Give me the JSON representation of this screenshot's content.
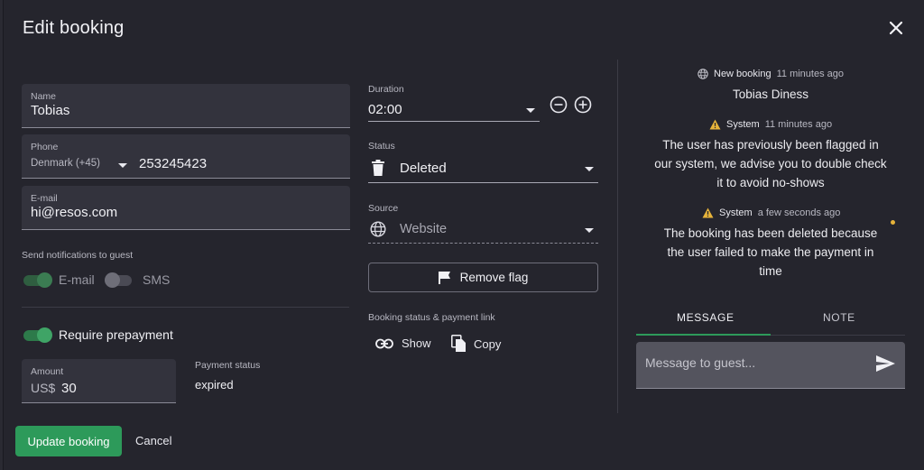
{
  "dialog": {
    "title": "Edit booking"
  },
  "guest": {
    "name_label": "Name",
    "name_value": "Tobias",
    "phone_label": "Phone",
    "country": "Denmark (+45)",
    "phone_value": "253245423",
    "email_label": "E-mail",
    "email_value": "hi@resos.com"
  },
  "notifications": {
    "label": "Send notifications to guest",
    "email": "E-mail",
    "sms": "SMS"
  },
  "prepayment": {
    "toggle_label": "Require prepayment",
    "amount_label": "Amount",
    "currency": "US$",
    "amount_value": "30",
    "payment_status_label": "Payment status",
    "payment_status_value": "expired"
  },
  "duration": {
    "label": "Duration",
    "value": "02:00"
  },
  "status": {
    "label": "Status",
    "value": "Deleted"
  },
  "source": {
    "label": "Source",
    "value": "Website"
  },
  "remove_flag": "Remove flag",
  "payment_link": {
    "label": "Booking status & payment link",
    "show": "Show",
    "copy": "Copy"
  },
  "activity": [
    {
      "type": "New booking",
      "time": "11 minutes ago",
      "text": "Tobias Diness"
    },
    {
      "type": "System",
      "time": "11 minutes ago",
      "text": "The user has previously been flagged in our system, we advise you to double check it to avoid no-shows"
    },
    {
      "type": "System",
      "time": "a few seconds ago",
      "text": "The booking has been deleted because the user failed to make the payment in time"
    }
  ],
  "tabs": [
    "MESSAGE",
    "NOTE"
  ],
  "message": {
    "placeholder": "Message to guest..."
  },
  "footer": {
    "update": "Update booking",
    "cancel": "Cancel"
  },
  "colors": {
    "accent": "#2d9a5a",
    "warning": "#e6b33a",
    "background": "#25252d"
  }
}
